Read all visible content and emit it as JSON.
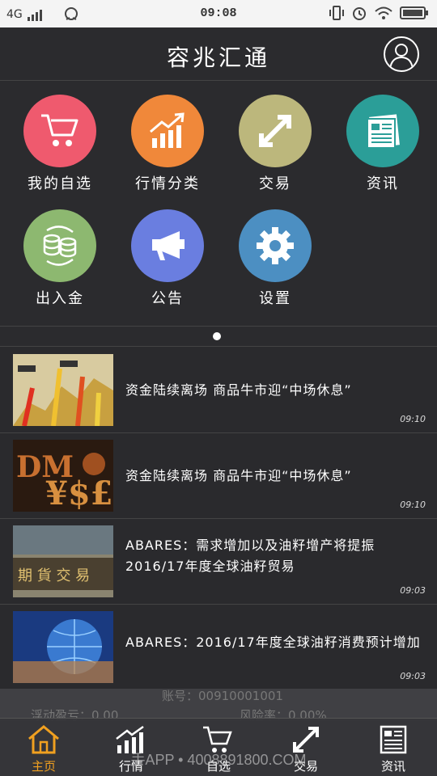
{
  "status": {
    "network": "4G",
    "time": "09:08"
  },
  "header": {
    "title": "容兆汇通"
  },
  "colors": {
    "bg": "#2a2a2d",
    "watchlist": "#ef5a6e",
    "category": "#f0883a",
    "trade": "#bcb77c",
    "news": "#2b9e98",
    "deposit": "#8db870",
    "notice": "#6a7ee0",
    "settings": "#4c8fc2",
    "active_tab": "#f0a020"
  },
  "menu": [
    {
      "label": "我的自选",
      "icon": "cart-icon"
    },
    {
      "label": "行情分类",
      "icon": "chart-up-icon"
    },
    {
      "label": "交易",
      "icon": "exchange-arrows-icon"
    },
    {
      "label": "资讯",
      "icon": "newspaper-icon"
    },
    {
      "label": "出入金",
      "icon": "coins-exchange-icon"
    },
    {
      "label": "公告",
      "icon": "megaphone-icon"
    },
    {
      "label": "设置",
      "icon": "gear-icon"
    }
  ],
  "news": [
    {
      "title": "资金陆续离场 商品牛市迎“中场休息”",
      "time": "09:10"
    },
    {
      "title": "资金陆续离场 商品牛市迎“中场休息”",
      "time": "09:10"
    },
    {
      "title": "ABARES：需求增加以及油籽增产将提振2016/17年度全球油籽贸易",
      "time": "09:03"
    },
    {
      "title": "ABARES：2016/17年度全球油籽消费预计增加",
      "time": "09:03"
    }
  ],
  "account": {
    "line1": "账号：00910001001",
    "float_pnl": "浮动盈亏：0.00",
    "risk": "风险率：0.00%"
  },
  "tabs": [
    {
      "label": "主页",
      "icon": "home-icon"
    },
    {
      "label": "行情",
      "icon": "chart-up-icon"
    },
    {
      "label": "自选",
      "icon": "cart-icon"
    },
    {
      "label": "交易",
      "icon": "exchange-arrows-icon"
    },
    {
      "label": "资讯",
      "icon": "newspaper-icon"
    }
  ],
  "watermark": "手APP • 4008891800.COM"
}
